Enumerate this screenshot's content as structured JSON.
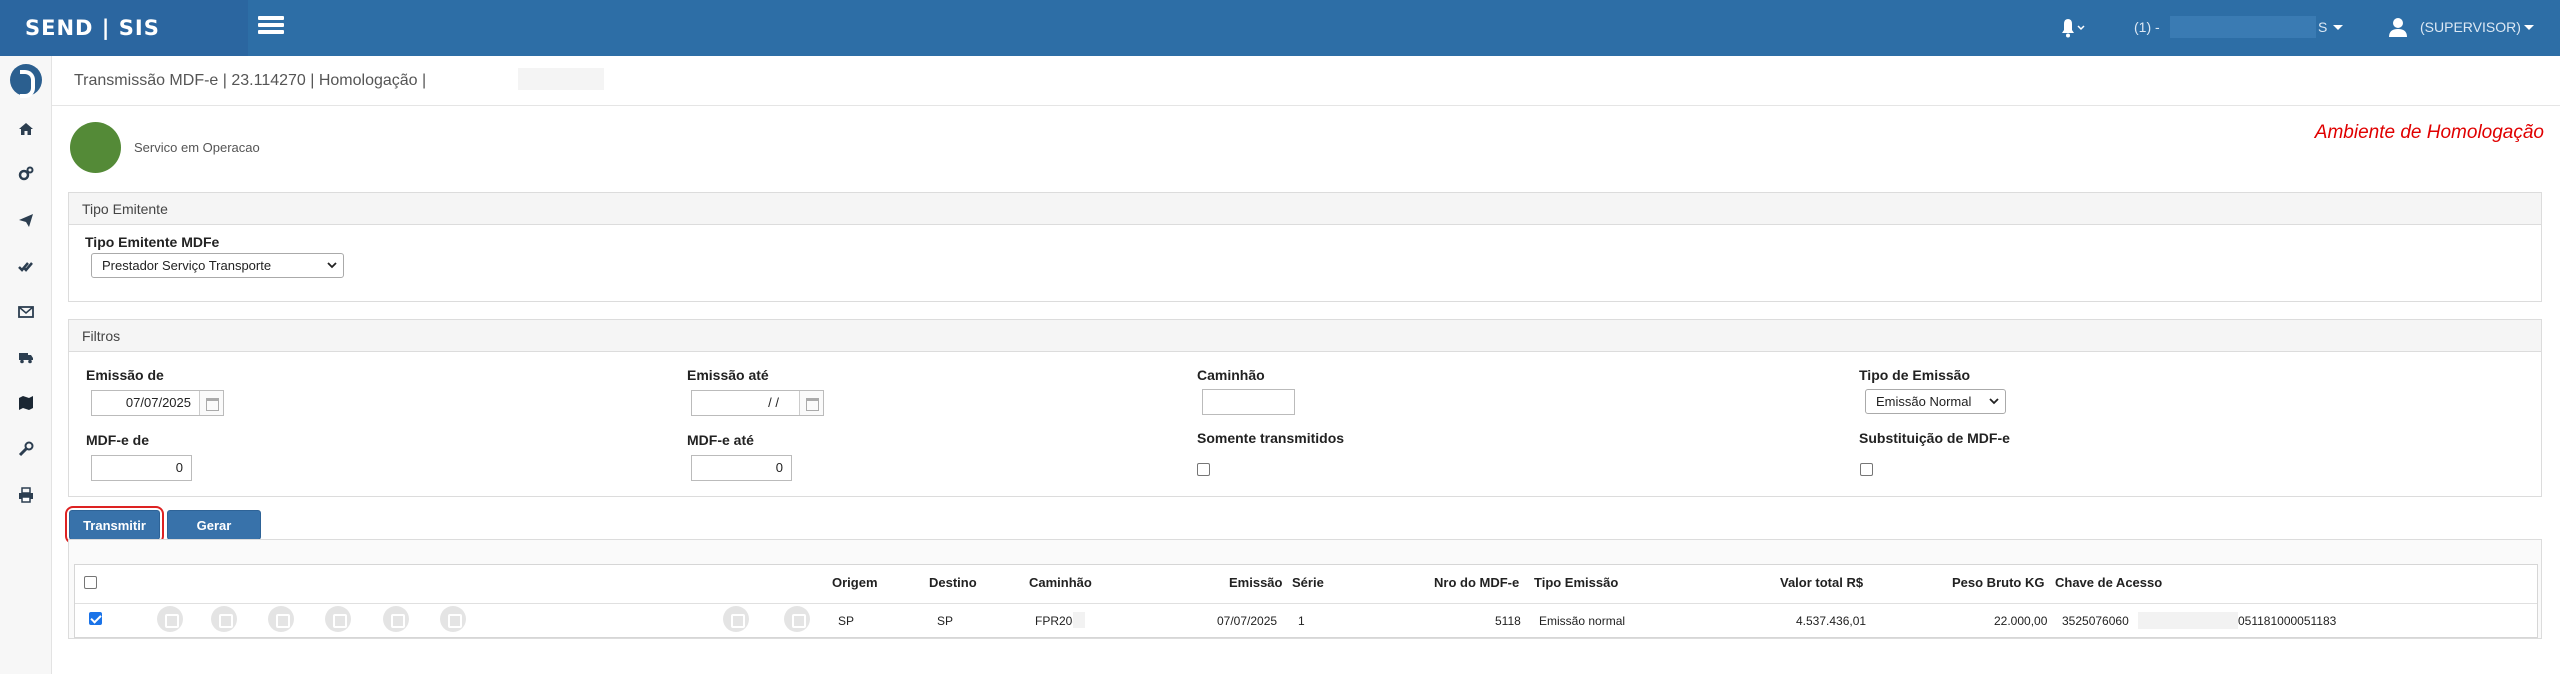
{
  "app": {
    "brand": "SEND | SIS"
  },
  "topbar": {
    "user_prefix": "(1) -",
    "user_suffix": "S",
    "role": "(SUPERVISOR)"
  },
  "sidebar": {
    "items": [
      "home-icon",
      "cogs-icon",
      "paper-plane-icon",
      "check-double-icon",
      "envelope-icon",
      "truck-icon",
      "map-icon",
      "wrench-icon",
      "print-icon"
    ]
  },
  "page": {
    "title": "Transmissão MDF-e | 23.114270 | Homologação |"
  },
  "status": {
    "text": "Servico em Operacao",
    "color": "#548a37",
    "env": "Ambiente de Homologação"
  },
  "emitente": {
    "panel_title": "Tipo Emitente",
    "label": "Tipo Emitente MDFe",
    "selected": "Prestador Serviço Transporte"
  },
  "filtros": {
    "panel_title": "Filtros",
    "emissao_de": {
      "label": "Emissão de",
      "value": "07/07/2025"
    },
    "emissao_ate": {
      "label": "Emissão até",
      "value": "/ /"
    },
    "caminhao": {
      "label": "Caminhão",
      "value": ""
    },
    "tipo_emissao": {
      "label": "Tipo de Emissão",
      "selected": "Emissão Normal"
    },
    "mdfe_de": {
      "label": "MDF-e de",
      "value": "0"
    },
    "mdfe_ate": {
      "label": "MDF-e até",
      "value": "0"
    },
    "somente": {
      "label": "Somente transmitidos",
      "checked": false
    },
    "substituicao": {
      "label": "Substituição de MDF-e",
      "checked": false
    }
  },
  "buttons": {
    "transmitir": "Transmitir",
    "gerar": "Gerar"
  },
  "grid": {
    "columns": [
      "Origem",
      "Destino",
      "Caminhão",
      "Emissão",
      "Série",
      "Nro do MDF-e",
      "Tipo Emissão",
      "Valor total R$",
      "Peso Bruto KG",
      "Chave de Acesso"
    ],
    "rows": [
      {
        "checked": true,
        "origem": "SP",
        "destino": "SP",
        "caminhao": "FPR20-",
        "emissao": "07/07/2025",
        "serie": "1",
        "nro": "5118",
        "tipo": "Emissão normal",
        "valor": "4.537.436,01",
        "peso": "22.000,00",
        "chave_inicio": "3525076060",
        "chave_fim": "051181000051183"
      }
    ],
    "row_actions": [
      "search-icon",
      "clock-icon",
      "file-icon",
      "close-icon",
      "book-icon",
      "copy-icon",
      "dollar-icon",
      "printer-icon"
    ]
  }
}
